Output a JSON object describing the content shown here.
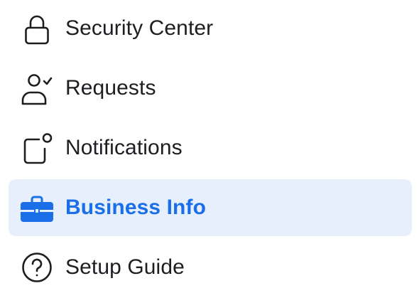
{
  "nav": {
    "items": [
      {
        "label": "Security Center",
        "icon": "lock-icon",
        "active": false
      },
      {
        "label": "Requests",
        "icon": "person-check-icon",
        "active": false
      },
      {
        "label": "Notifications",
        "icon": "notification-square-icon",
        "active": false
      },
      {
        "label": "Business Info",
        "icon": "briefcase-icon",
        "active": true
      },
      {
        "label": "Setup Guide",
        "icon": "question-circle-icon",
        "active": false
      }
    ]
  },
  "colors": {
    "active_background": "#e7effc",
    "active_text": "#1a6fe8",
    "text": "#1c1e21",
    "icon": "#1c1e21"
  }
}
